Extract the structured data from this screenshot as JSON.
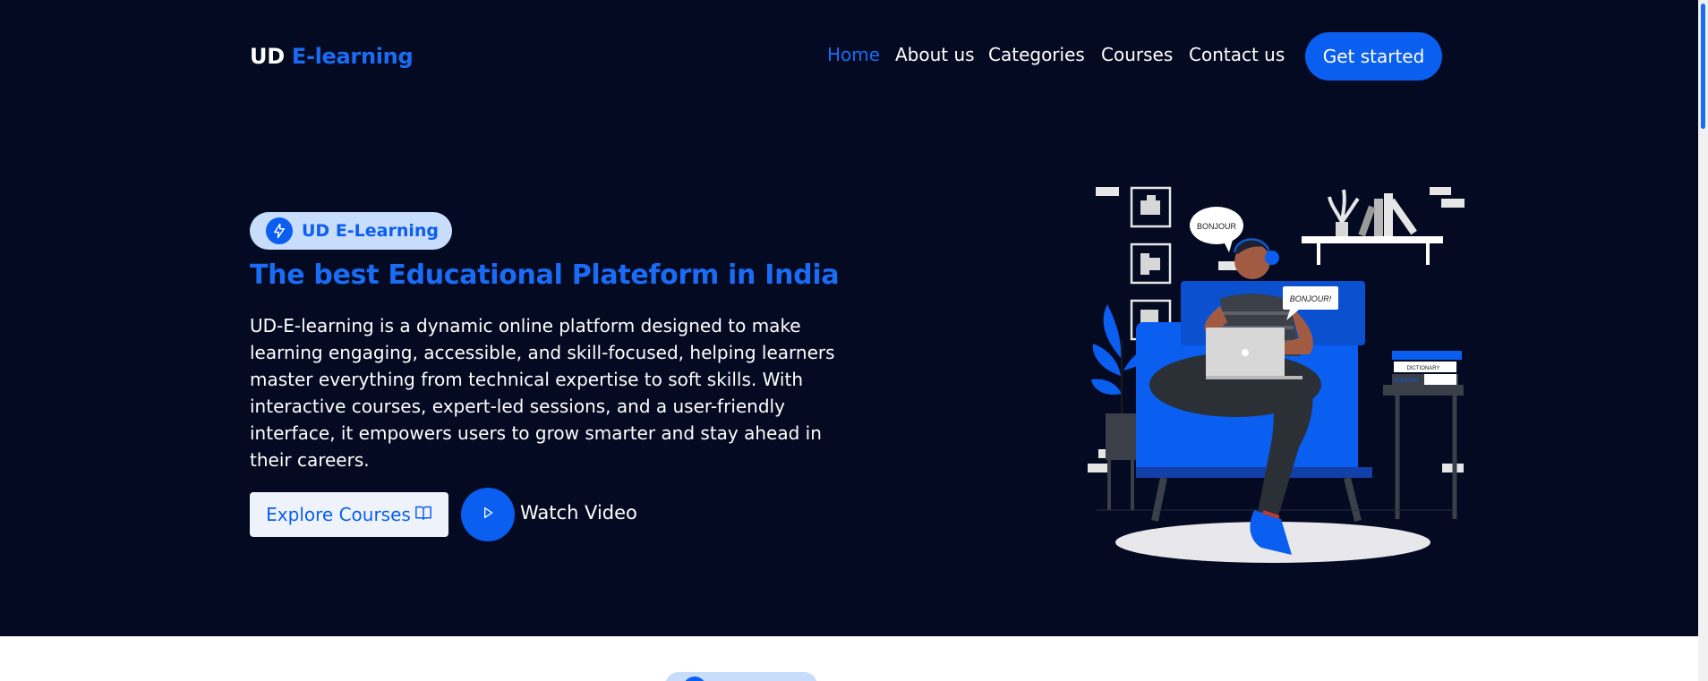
{
  "logo": {
    "part1": "UD",
    "part2": "E-learning"
  },
  "nav": {
    "items": [
      {
        "label": "Home",
        "active": true
      },
      {
        "label": "About us",
        "active": false
      },
      {
        "label": "Categories",
        "active": false
      },
      {
        "label": "Courses",
        "active": false
      },
      {
        "label": "Contact us",
        "active": false
      }
    ],
    "cta_label": "Get started"
  },
  "hero": {
    "badge_text": "UD E-Learning",
    "badge_icon": "lightning-icon",
    "title": "The best Educational Plateform in India",
    "description": "UD-E-learning is a dynamic online platform designed to make learning engaging, accessible, and skill-focused, helping learners master everything from technical expertise to soft skills. With interactive courses, expert-led sessions, and a user-friendly interface, it empowers users to grow smarter and stay ahead in their careers.",
    "explore_label": "Explore Courses",
    "explore_icon": "book-icon",
    "watch_label": "Watch Video",
    "play_icon": "play-icon"
  },
  "illustration": {
    "bubble1": "BONJOUR",
    "bubble2": "BONJOUR!",
    "book1": "DICTIONARY",
    "book2": "ENGLISH"
  },
  "colors": {
    "background": "#030a21",
    "accent": "#0a5ef0",
    "accent_light": "#1a6cf5",
    "badge_bg": "#c8dcfb"
  }
}
